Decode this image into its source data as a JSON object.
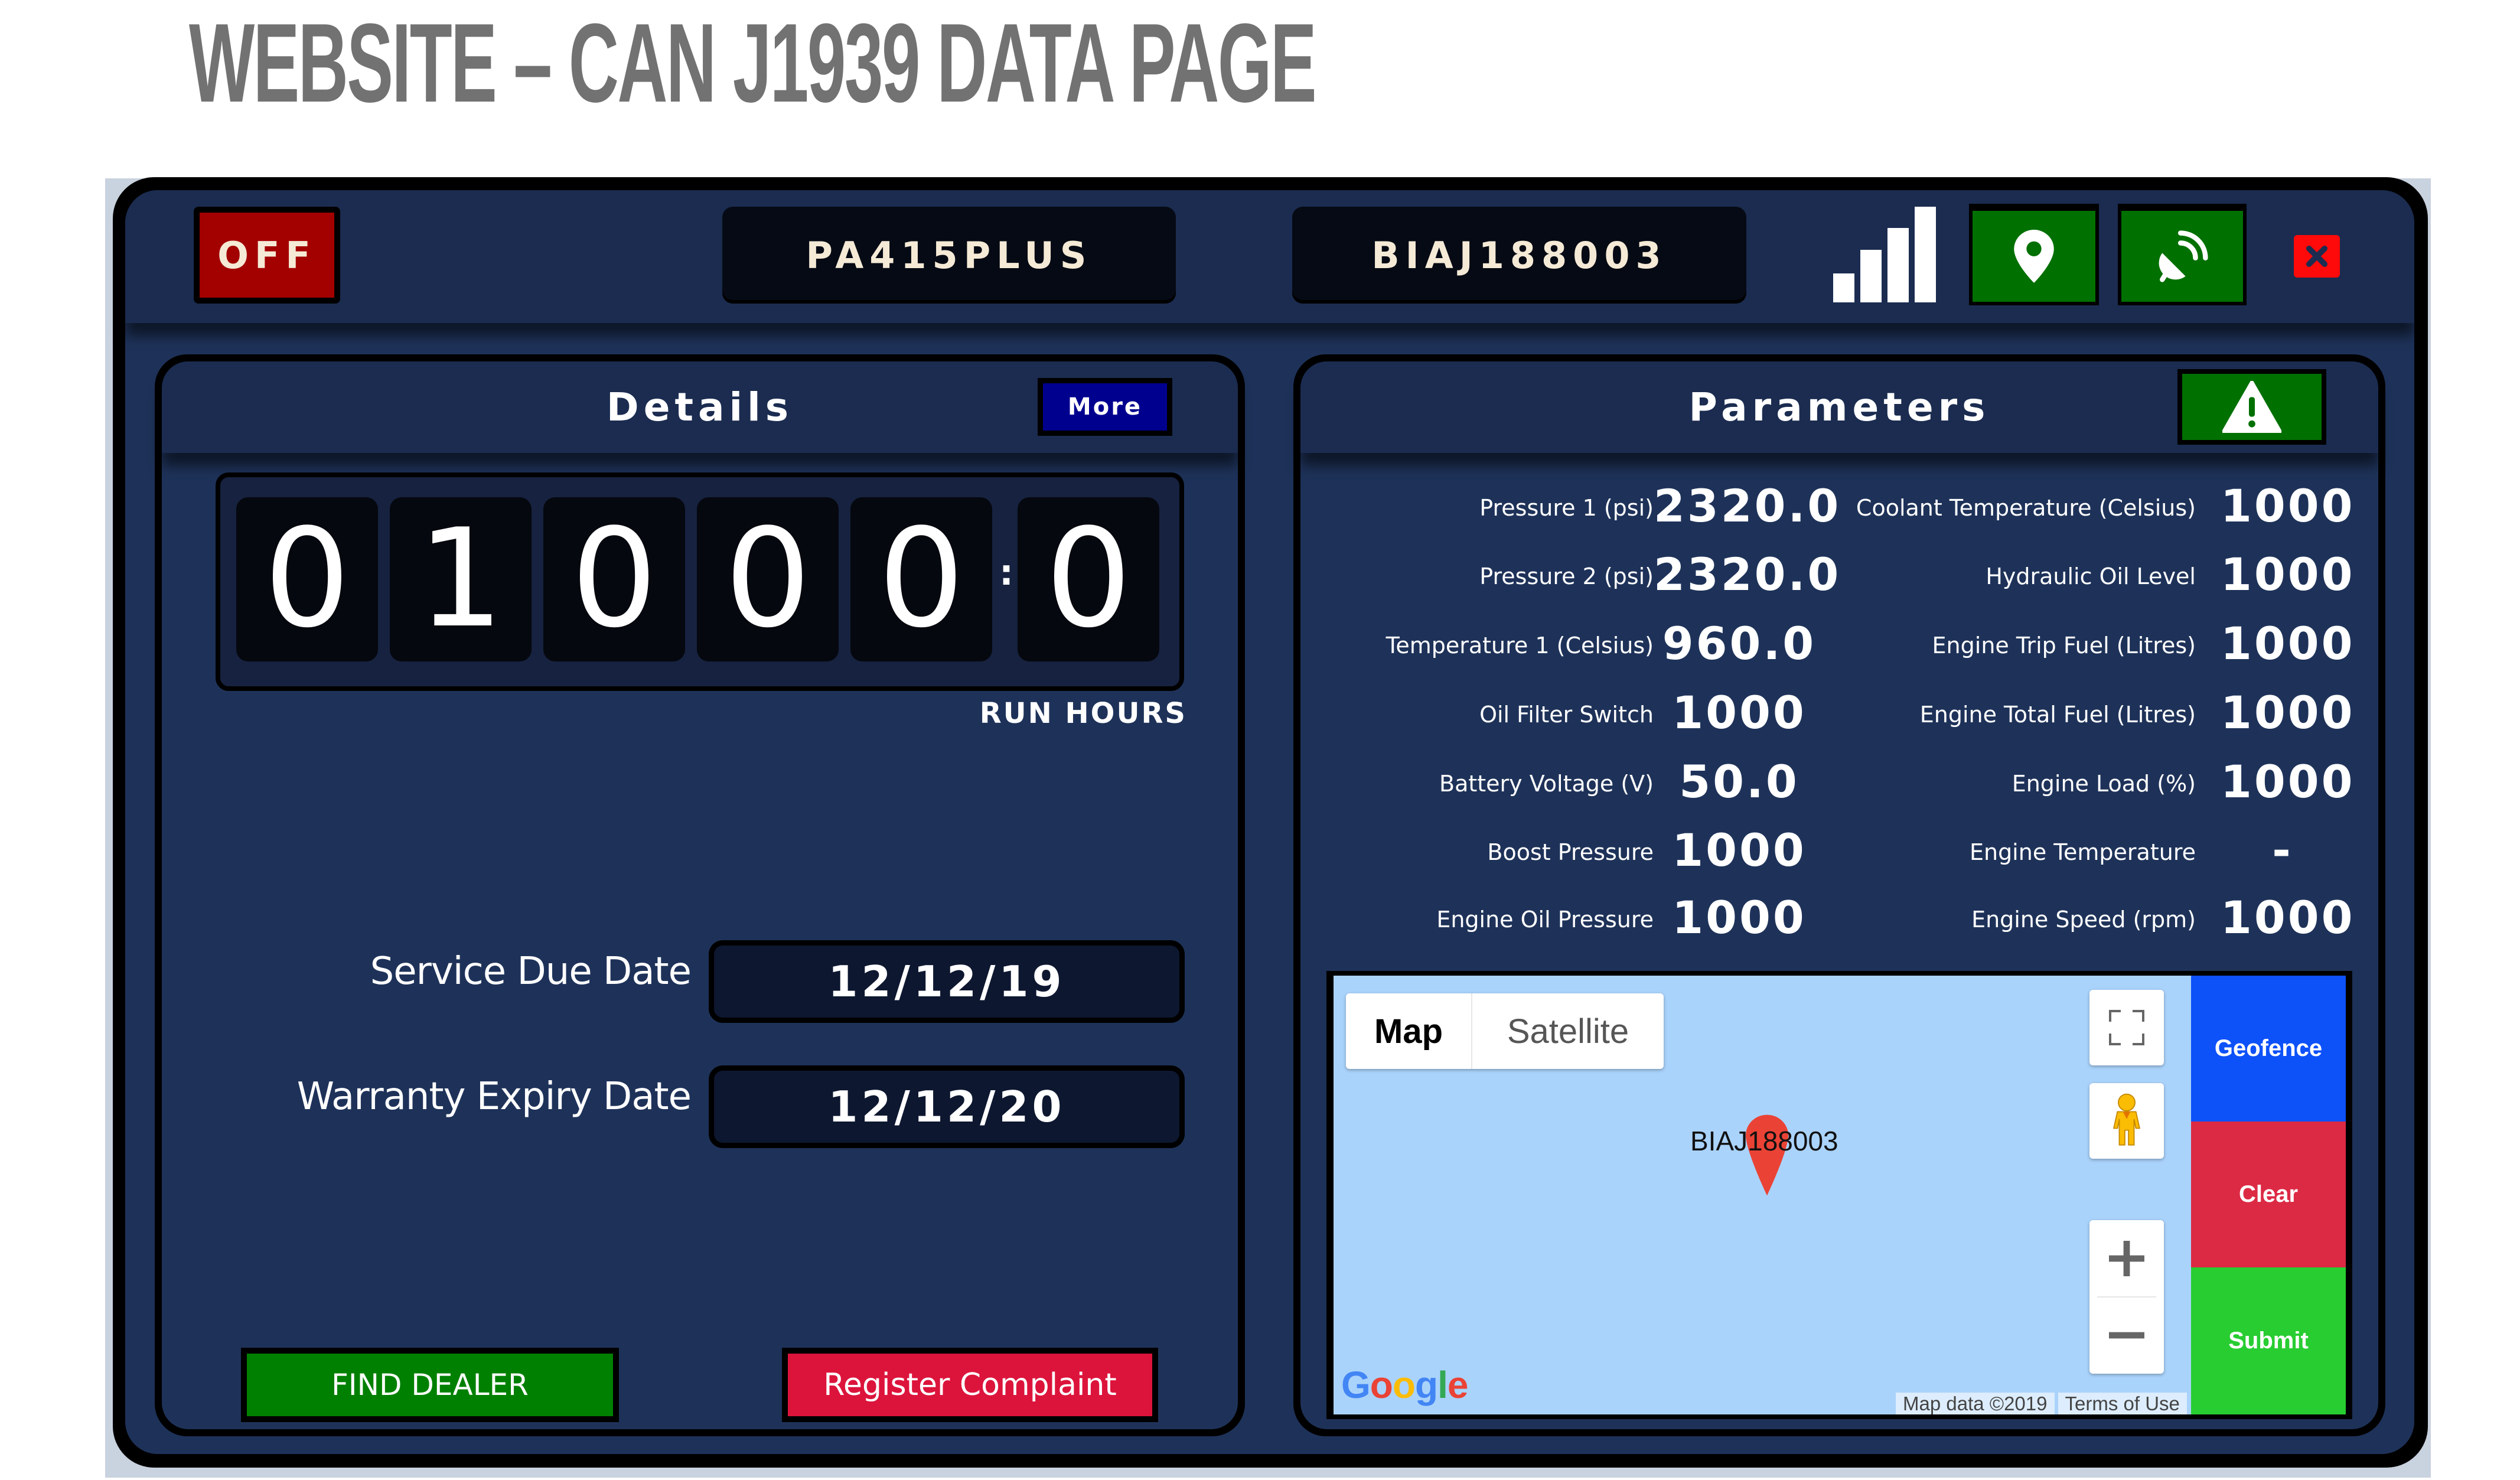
{
  "page_title": "WEBSITE – CAN J1939 DATA PAGE",
  "header": {
    "power_status": "OFF",
    "model": "PA415PLUS",
    "serial": "BIAJ188003",
    "signal_strength_bars": 4,
    "signal_max_bars": 4,
    "icons": {
      "signal": "signal-bars-icon",
      "location": "map-pin-icon",
      "satellite": "satellite-dish-icon",
      "close": "close-x-icon"
    }
  },
  "details": {
    "title": "Details",
    "more_label": "More",
    "run_hours_digits": [
      "0",
      "1",
      "0",
      "0",
      "0"
    ],
    "run_hours_decimal": "0",
    "run_hours_separator": ":",
    "run_hours_label": "RUN HOURS",
    "service_due_label": "Service Due Date",
    "service_due_value": "12/12/19",
    "warranty_expiry_label": "Warranty Expiry Date",
    "warranty_expiry_value": "12/12/20",
    "find_dealer_label": "FIND DEALER",
    "register_complaint_label": "Register Complaint"
  },
  "parameters": {
    "title": "Parameters",
    "alert_icon": "warning-triangle-icon",
    "left": [
      {
        "label": "Pressure 1 (psi)",
        "value": "2320.0"
      },
      {
        "label": "Pressure 2 (psi)",
        "value": "2320.0"
      },
      {
        "label": "Temperature 1 (Celsius)",
        "value": "960.0"
      },
      {
        "label": "Oil Filter Switch",
        "value": "1000"
      },
      {
        "label": "Battery Voltage (V)",
        "value": "50.0"
      },
      {
        "label": "Boost Pressure",
        "value": "1000"
      },
      {
        "label": "Engine Oil Pressure",
        "value": "1000"
      }
    ],
    "right": [
      {
        "label": "Coolant Temperature (Celsius)",
        "value": "1000"
      },
      {
        "label": "Hydraulic Oil Level",
        "value": "1000"
      },
      {
        "label": "Engine Trip Fuel (Litres)",
        "value": "1000"
      },
      {
        "label": "Engine Total Fuel (Litres)",
        "value": "1000"
      },
      {
        "label": "Engine Load (%)",
        "value": "1000"
      },
      {
        "label": "Engine Temperature",
        "value": "-"
      },
      {
        "label": "Engine Speed (rpm)",
        "value": "1000"
      }
    ]
  },
  "map": {
    "type_map": "Map",
    "type_satellite": "Satellite",
    "marker_label": "BIAJ188003",
    "logo": "Google",
    "attribution_data": "Map data ©2019",
    "attribution_terms": "Terms of Use",
    "zoom_in": "+",
    "zoom_out": "−",
    "geofence_label": "Geofence",
    "clear_label": "Clear",
    "submit_label": "Submit"
  },
  "colors": {
    "frame_bg": "#1e3259",
    "off_red": "#a30000",
    "green": "#007000",
    "more_blue": "#00008f",
    "complaint_red": "#dc143c",
    "map_water": "#aad3fb",
    "geofence_blue": "#0d51f9",
    "clear_red": "#dc2a45",
    "submit_green": "#27cd31"
  }
}
